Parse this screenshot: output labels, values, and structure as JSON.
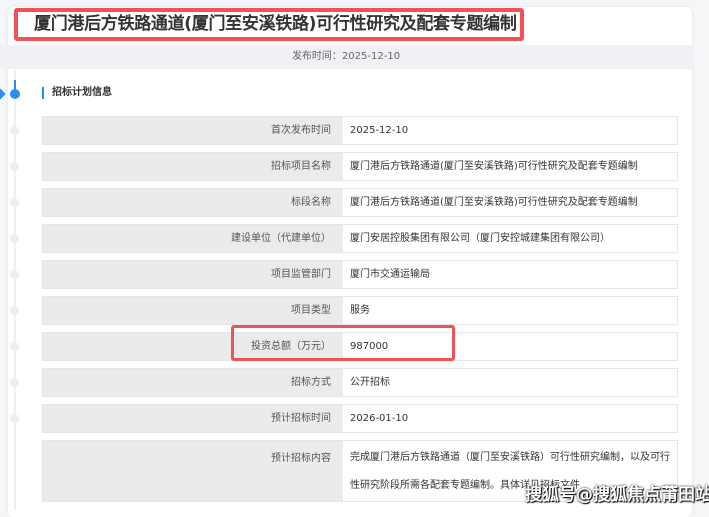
{
  "title": "厦门港后方铁路通道(厦门至安溪铁路)可行性研究及配套专题编制",
  "publish": {
    "label": "发布时间：",
    "value": "2025-12-10"
  },
  "section": "招标计划信息",
  "rows": [
    {
      "label": "首次发布时间",
      "value": "2025-12-10"
    },
    {
      "label": "招标项目名称",
      "value": "厦门港后方铁路通道(厦门至安溪铁路)可行性研究及配套专题编制"
    },
    {
      "label": "标段名称",
      "value": "厦门港后方铁路通道(厦门至安溪铁路)可行性研究及配套专题编制"
    },
    {
      "label": "建设单位（代建单位）",
      "value": "厦门安居控股集团有限公司（厦门安控城建集团有限公司）"
    },
    {
      "label": "项目监管部门",
      "value": "厦门市交通运输局"
    },
    {
      "label": "项目类型",
      "value": "服务"
    },
    {
      "label": "投资总额（万元）",
      "value": "987000"
    },
    {
      "label": "招标方式",
      "value": "公开招标"
    },
    {
      "label": "预计招标时间",
      "value": "2026-01-10"
    },
    {
      "label": "预计招标内容",
      "value": "完成厦门港后方铁路通道（厦门至安溪铁路）可行性研究编制，以及可行性研究阶段所需各配套专题编制。具体详见招标文件"
    }
  ],
  "watermark": "搜狐号@搜狐焦点莆田站",
  "colors": {
    "accent": "#2d8cf0",
    "highlight": "#f25257"
  }
}
